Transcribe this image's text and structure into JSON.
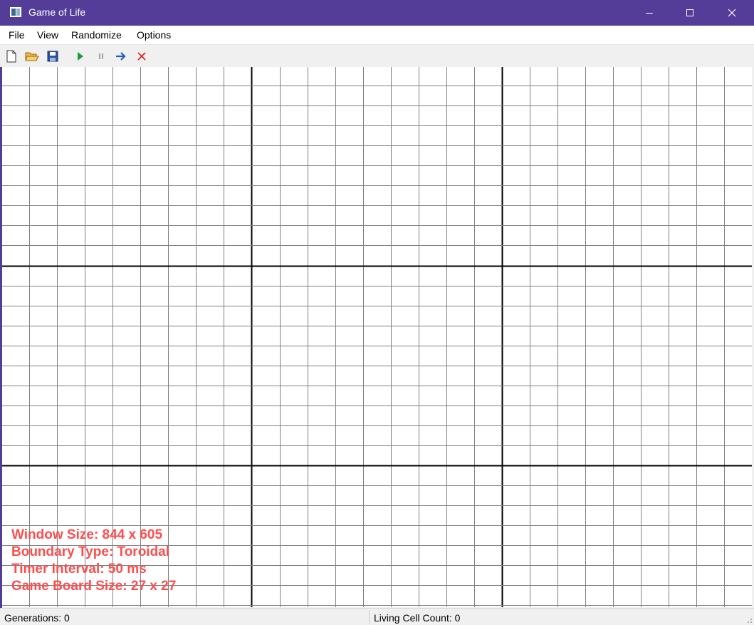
{
  "window": {
    "title": "Game of Life",
    "app_icon": "app-window-icon",
    "controls": [
      "minimize-icon",
      "maximize-icon",
      "close-icon"
    ]
  },
  "menu": {
    "items": [
      "File",
      "View",
      "Randomize",
      "Options"
    ]
  },
  "toolbar": {
    "buttons": [
      "new-file-icon",
      "open-folder-icon",
      "save-disk-icon",
      "play-icon",
      "pause-icon",
      "next-step-arrow-icon",
      "clear-x-icon"
    ]
  },
  "board": {
    "grid_color": "#808080",
    "hud_color": "#ff4d4d",
    "hud": {
      "window_size": "Window Size: 844 x 605",
      "boundary_type": "Boundary Type: Toroidal",
      "timer_interval": "Timer Interval: 50 ms",
      "board_size": "Game Board Size: 27 x 27"
    }
  },
  "status": {
    "generations": "Generations: 0",
    "living_cells": "Living Cell Count: 0"
  }
}
